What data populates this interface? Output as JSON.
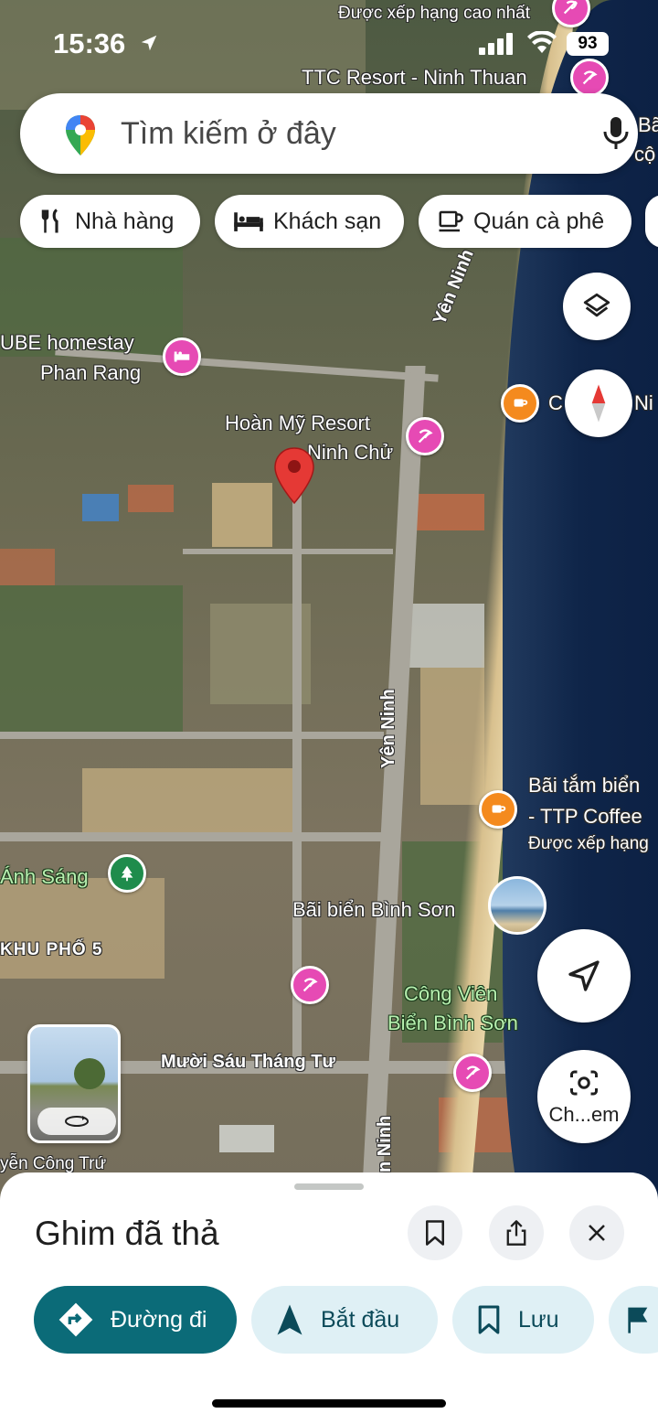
{
  "status_bar": {
    "time": "15:36",
    "battery": "93"
  },
  "search": {
    "placeholder": "Tìm kiếm ở đây"
  },
  "chips": [
    {
      "label": "Nhà hàng",
      "icon": "restaurant-icon"
    },
    {
      "label": "Khách sạn",
      "icon": "hotel-icon"
    },
    {
      "label": "Quán cà phê",
      "icon": "coffee-icon"
    }
  ],
  "map": {
    "labels": {
      "top_ranked": "Được xếp hạng cao nhất",
      "ttc_resort": "TTC Resort - Ninh Thuan",
      "homestay_1": "UBE homestay",
      "homestay_2": "Phan Rang",
      "hoan_my_1": "Hoàn Mỹ Resort",
      "hoan_my_2": "Ninh Chử",
      "cafe_short": "C",
      "right_edge_1": "Ni",
      "right_edge_top_1": "Bã",
      "right_edge_top_2": "cộ",
      "beach_cafe_1": "Bãi tắm biển",
      "beach_cafe_2": "- TTP Coffee",
      "beach_cafe_3": "Được xếp hạng",
      "anh_sang": "Ánh Sáng",
      "binh_son_beach": "Bãi biển Bình Sơn",
      "khu_pho_5": "KHU PHỐ 5",
      "park_1": "Công Viên",
      "park_2": "Biển Bình Sơn",
      "nguyen_cong_tru": "yễn Công Trứ"
    },
    "roads": {
      "yen_ninh_top": "Yên Ninh",
      "yen_ninh_mid": "Yên Ninh",
      "yen_ninh_bottom": "n Ninh",
      "muoi_sau_thang_tu": "Mười Sáu Tháng Tư"
    }
  },
  "camera_search": {
    "label": "Ch...em"
  },
  "sheet": {
    "title": "Ghim đã thả",
    "actions": [
      {
        "label": "Đường đi",
        "style": "primary"
      },
      {
        "label": "Bắt đầu",
        "style": "secondary"
      },
      {
        "label": "Lưu",
        "style": "secondary"
      }
    ]
  },
  "colors": {
    "primary": "#0b6b78",
    "pin": "#e53935",
    "poi_pink": "#e64ab4",
    "poi_orange": "#f48a1e"
  }
}
